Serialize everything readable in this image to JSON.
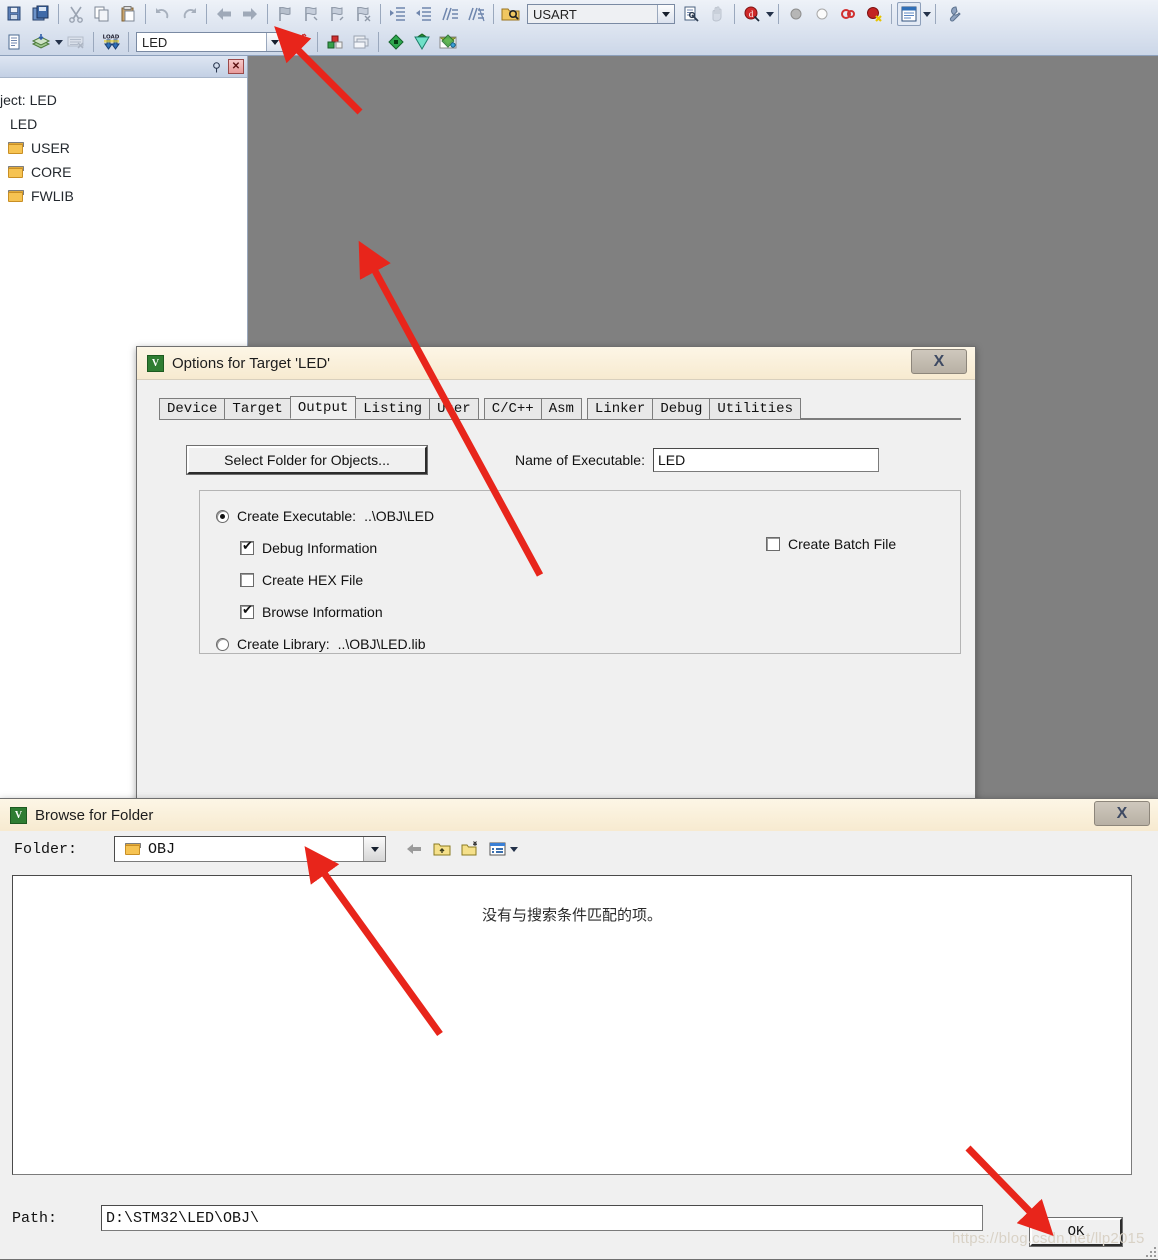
{
  "app": {
    "editor_background": "#808080"
  },
  "toolbar_row1": {
    "groups": [
      {
        "items": [
          {
            "name": "save-all-icon",
            "glyph": "🖫"
          },
          {
            "name": "save-icon",
            "glyph": "🗗"
          }
        ]
      },
      {
        "items": [
          {
            "name": "cut-icon",
            "glyph": "✄"
          },
          {
            "name": "copy-icon",
            "glyph": "⧉"
          },
          {
            "name": "paste-icon",
            "glyph": "📋"
          }
        ]
      },
      {
        "items": [
          {
            "name": "undo-icon",
            "glyph": "↶"
          },
          {
            "name": "redo-icon",
            "glyph": "↷"
          }
        ]
      },
      {
        "items": [
          {
            "name": "navigate-back-icon",
            "glyph": "⬅"
          },
          {
            "name": "navigate-forward-icon",
            "glyph": "➡"
          }
        ]
      },
      {
        "items": [
          {
            "name": "bookmark-toggle-icon",
            "glyph": "⚑"
          },
          {
            "name": "bookmark-prev-icon",
            "glyph": "⚐"
          },
          {
            "name": "bookmark-next-icon",
            "glyph": "⚐"
          },
          {
            "name": "bookmark-clear-icon",
            "glyph": "⚐"
          }
        ]
      },
      {
        "items": [
          {
            "name": "indent-increase-icon",
            "glyph": "⇥"
          },
          {
            "name": "indent-decrease-icon",
            "glyph": "⇤"
          },
          {
            "name": "comment-lines-icon",
            "glyph": "//"
          },
          {
            "name": "uncomment-lines-icon",
            "glyph": "//"
          }
        ]
      },
      {
        "items": [
          {
            "name": "find-in-files-icon",
            "glyph": "🔎"
          }
        ]
      }
    ],
    "search_combo": {
      "name": "search-combo",
      "value": "USART",
      "placeholder": "USART"
    },
    "right_items": [
      {
        "name": "find-icon",
        "glyph": "🔍"
      },
      {
        "name": "incremental-find-icon",
        "glyph": "✋"
      },
      {
        "name": "debug-search-icon",
        "glyph": "Q"
      },
      {
        "name": "breakpoint-disabled-icon",
        "glyph": "●"
      },
      {
        "name": "breakpoint-empty-icon",
        "glyph": "○"
      },
      {
        "name": "breakpoint-toggle-icon",
        "glyph": "⭕"
      },
      {
        "name": "breakpoint-kill-all-icon",
        "glyph": "⬤"
      },
      {
        "name": "project-window-icon",
        "glyph": "▤"
      },
      {
        "name": "configure-icon",
        "glyph": "🔧"
      }
    ]
  },
  "toolbar_row2": {
    "left_items": [
      {
        "name": "translate-file-icon",
        "glyph": "📄"
      },
      {
        "name": "build-target-icon",
        "glyph": "🗂"
      },
      {
        "name": "build-dropdown-icon",
        "glyph": "▾"
      },
      {
        "name": "rebuild-all-icon",
        "glyph": "▦"
      },
      {
        "name": "load-to-flash-icon",
        "glyph": "LOAD"
      }
    ],
    "target_combo": {
      "name": "target-combo",
      "value": "LED",
      "placeholder": "LED"
    },
    "right_items": [
      {
        "name": "options-for-target-icon",
        "glyph": "🪄"
      },
      {
        "name": "manage-project-items-icon",
        "glyph": "🧱"
      },
      {
        "name": "manage-multi-project-icon",
        "glyph": "🗐"
      },
      {
        "name": "pack-installer-icon",
        "glyph": "◆"
      },
      {
        "name": "manage-run-time-icon",
        "glyph": "◈"
      },
      {
        "name": "select-software-packs-icon",
        "glyph": "❖"
      }
    ]
  },
  "project_pane": {
    "name": "project-window",
    "pin_icon": "pin-icon",
    "close_icon": "close-icon",
    "title": "ject: LED",
    "root": "LED",
    "folders": [
      {
        "label": "USER"
      },
      {
        "label": "CORE"
      },
      {
        "label": "FWLIB"
      }
    ]
  },
  "options_dialog": {
    "title": "Options for Target 'LED'",
    "close_label": "X",
    "tabs": [
      {
        "label": "Device",
        "active": false
      },
      {
        "label": "Target",
        "active": false
      },
      {
        "label": "Output",
        "active": true
      },
      {
        "label": "Listing",
        "active": false
      },
      {
        "label": "User",
        "active": false
      },
      {
        "label": "C/C++",
        "active": false
      },
      {
        "label": "Asm",
        "active": false
      },
      {
        "label": "Linker",
        "active": false
      },
      {
        "label": "Debug",
        "active": false
      },
      {
        "label": "Utilities",
        "active": false
      }
    ],
    "select_folder_button": "Select Folder for Objects...",
    "executable_label": "Name of Executable:",
    "executable_value": "LED",
    "create_executable": {
      "label": "Create Executable:",
      "path": "..\\OBJ\\LED",
      "selected": true
    },
    "debug_information": {
      "label": "Debug Information",
      "checked": true
    },
    "create_hex_file": {
      "label": "Create HEX File",
      "checked": false
    },
    "browse_information": {
      "label": "Browse Information",
      "checked": true
    },
    "create_library": {
      "label": "Create Library:",
      "path": "..\\OBJ\\LED.lib",
      "selected": false
    },
    "create_batch_file": {
      "label": "Create Batch File",
      "checked": false
    }
  },
  "browse_dialog": {
    "title": "Browse for Folder",
    "close_label": "X",
    "folder_label": "Folder:",
    "folder_value": "OBJ",
    "nav_icons": [
      {
        "name": "back-arrow-icon"
      },
      {
        "name": "up-one-level-icon"
      },
      {
        "name": "new-folder-icon"
      },
      {
        "name": "views-icon"
      },
      {
        "name": "views-dropdown-icon"
      }
    ],
    "empty_message": "没有与搜索条件匹配的项。",
    "path_label": "Path:",
    "path_value": "D:\\STM32\\LED\\OBJ\\",
    "ok_button": "OK"
  },
  "watermark": "https://blog.csdn.net/llp2015"
}
